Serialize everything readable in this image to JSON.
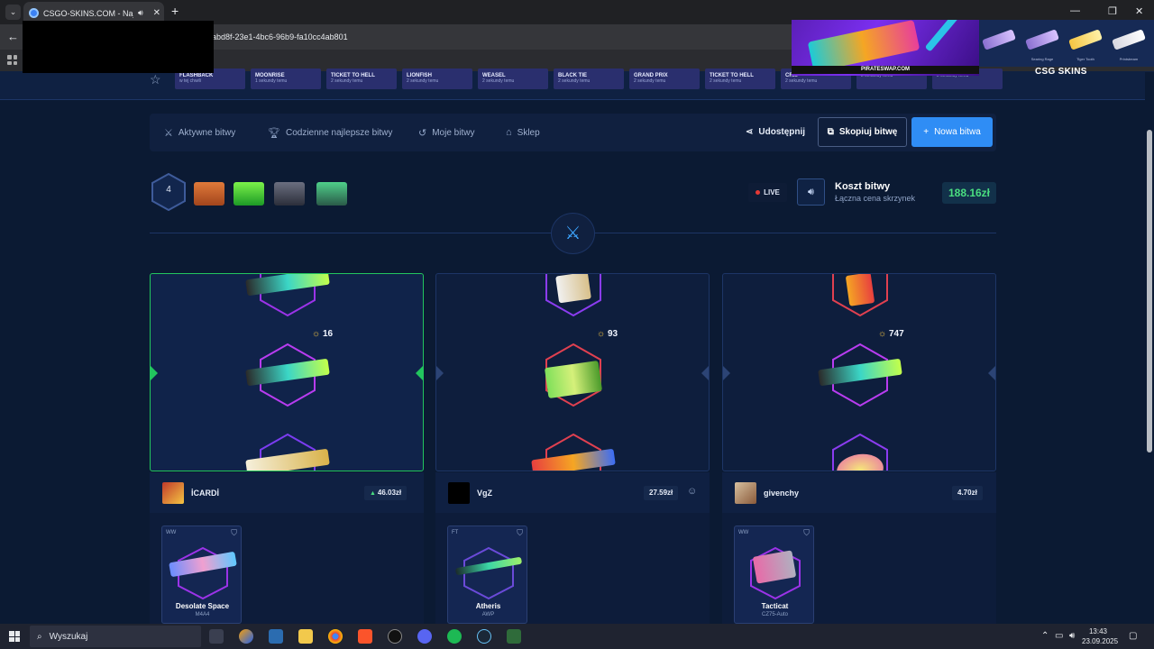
{
  "browser": {
    "tab_title": "CSGO-SKINS.COM - Najlep",
    "url": "abd8f-23e1-4bc6-96b9-fa10cc4ab801"
  },
  "drops": [
    {
      "name": "FLASHBACK",
      "time": "w tej chwili"
    },
    {
      "name": "MOONRISE",
      "time": "1 sekundy temu"
    },
    {
      "name": "TICKET TO HELL",
      "time": "2 sekundy temu"
    },
    {
      "name": "LIONFISH",
      "time": "2 sekundy temu"
    },
    {
      "name": "WEASEL",
      "time": "2 sekundy temu"
    },
    {
      "name": "BLACK TIE",
      "time": "2 sekundy temu"
    },
    {
      "name": "GRAND PRIX",
      "time": "2 sekundy temu"
    },
    {
      "name": "TICKET TO HELL",
      "time": "2 sekundy temu"
    },
    {
      "name": "CR...",
      "time": "2 sekundy temu"
    },
    {
      "name": "",
      "time": "2 sekundy temu"
    },
    {
      "name": "",
      "time": "2 sekundy temu"
    }
  ],
  "ad": {
    "text": "PIRATESWAP.COM"
  },
  "right_drops": [
    "",
    "Searing Rage",
    "Tiger Tooth",
    "Printstream"
  ],
  "brand": "CSG SKINS",
  "nav": {
    "items": [
      "Aktywne bitwy",
      "Codzienne najlepsze bitwy",
      "Moje bitwy",
      "Sklep"
    ],
    "share": "Udostępnij",
    "copy": "Skopiuj bitwę",
    "new": "Nowa bitwa"
  },
  "battle": {
    "round": "4",
    "live": "LIVE",
    "cost_title": "Koszt bitwy",
    "cost_sub": "Łączna cena skrzynek",
    "cost": "188.16zł"
  },
  "players": [
    {
      "name": "İCARDİ",
      "value": "46.03zł",
      "points": "16",
      "item": {
        "cond": "WW",
        "name": "Desolate Space",
        "type": "M4A4"
      }
    },
    {
      "name": "VgZ",
      "value": "27.59zł",
      "points": "93",
      "item": {
        "cond": "FT",
        "name": "Atheris",
        "type": "AWP"
      }
    },
    {
      "name": "givenchy",
      "value": "4.70zł",
      "points": "747",
      "item": {
        "cond": "WW",
        "name": "Tacticat",
        "type": "CZ75-Auto"
      }
    }
  ],
  "taskbar": {
    "search": "Wyszukaj",
    "time": "13:43",
    "date": "23.09.2025"
  },
  "colors": {
    "accent": "#2f8df5",
    "win": "#22c55e",
    "price": "#4ade80",
    "bg": "#0b1a33"
  }
}
